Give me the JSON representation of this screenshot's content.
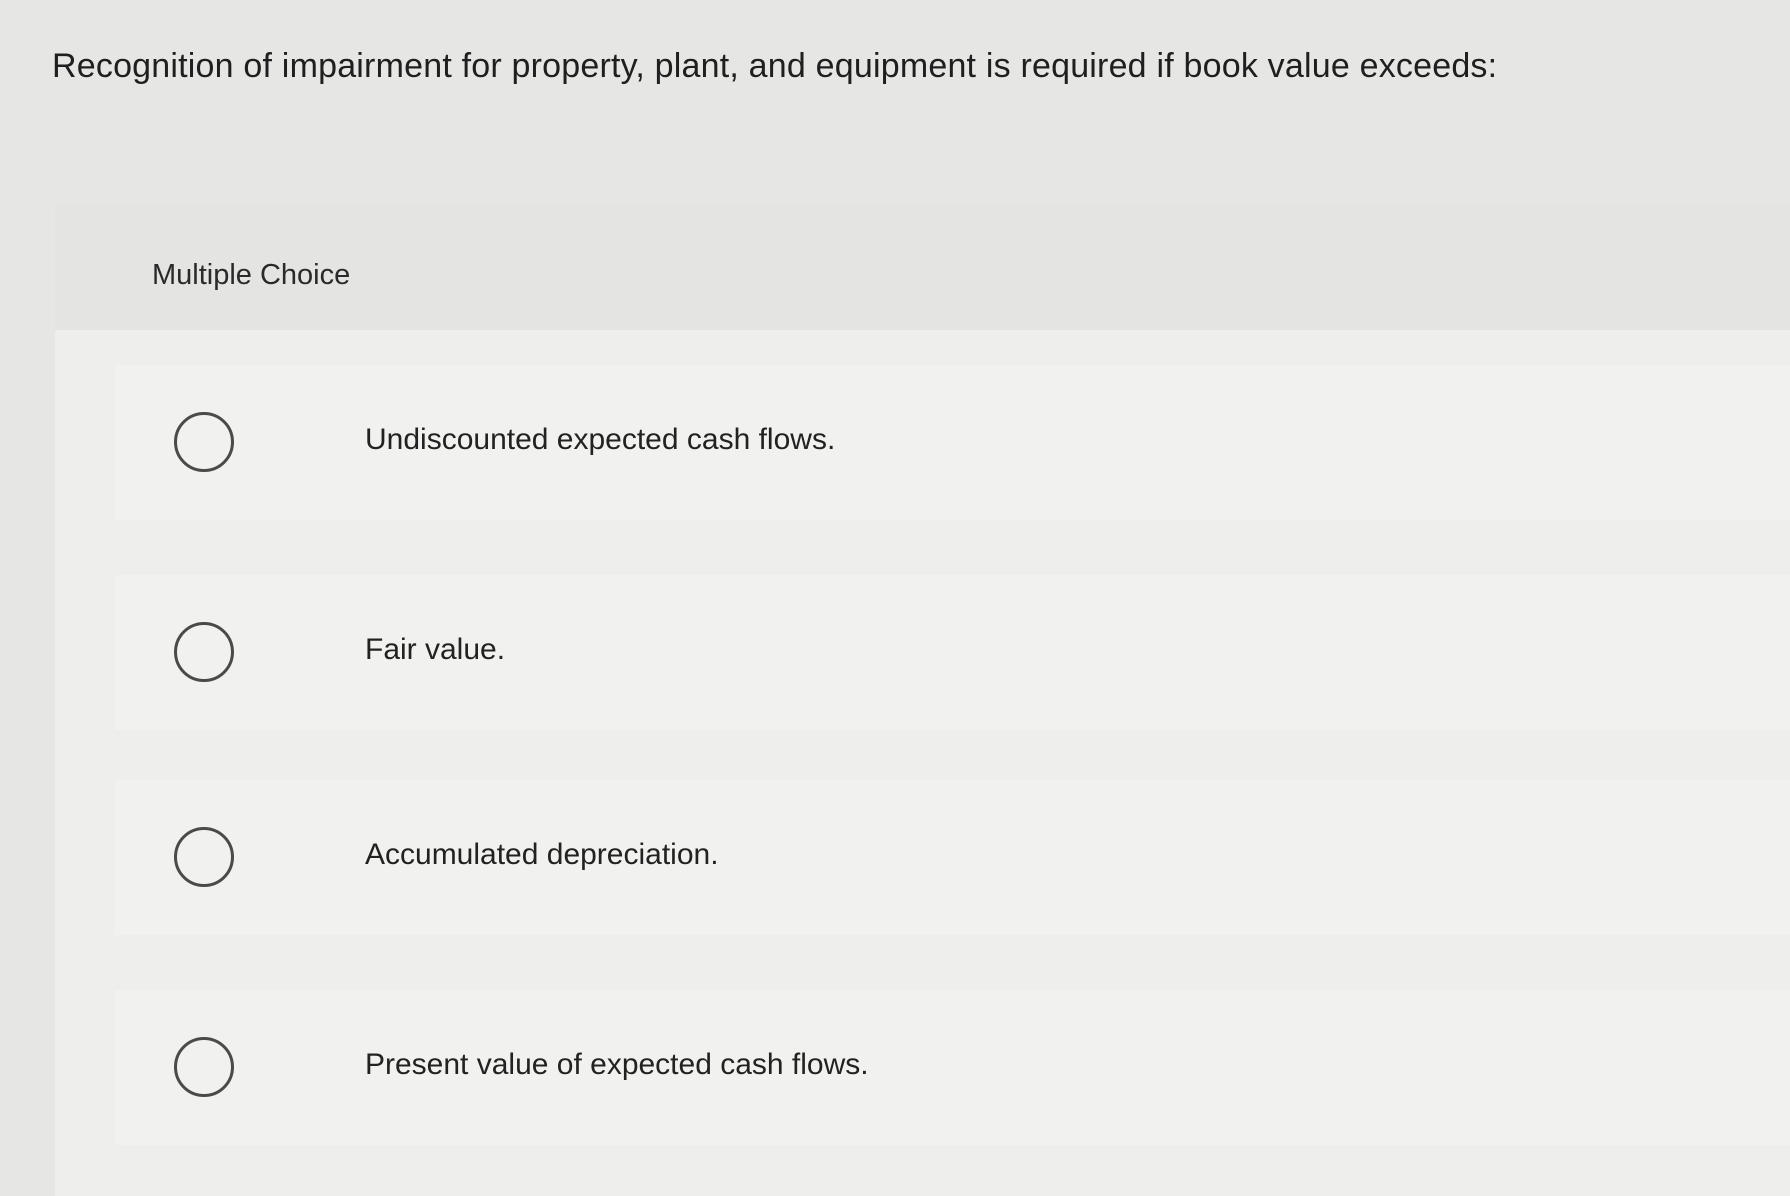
{
  "question": {
    "text": "Recognition of impairment for property, plant, and equipment is required if book value exceeds:"
  },
  "panel": {
    "title": "Multiple Choice"
  },
  "options": [
    {
      "label": "Undiscounted expected cash flows.",
      "selected": false
    },
    {
      "label": "Fair value.",
      "selected": false
    },
    {
      "label": "Accumulated depreciation.",
      "selected": false
    },
    {
      "label": "Present value of expected cash flows.",
      "selected": false
    }
  ]
}
